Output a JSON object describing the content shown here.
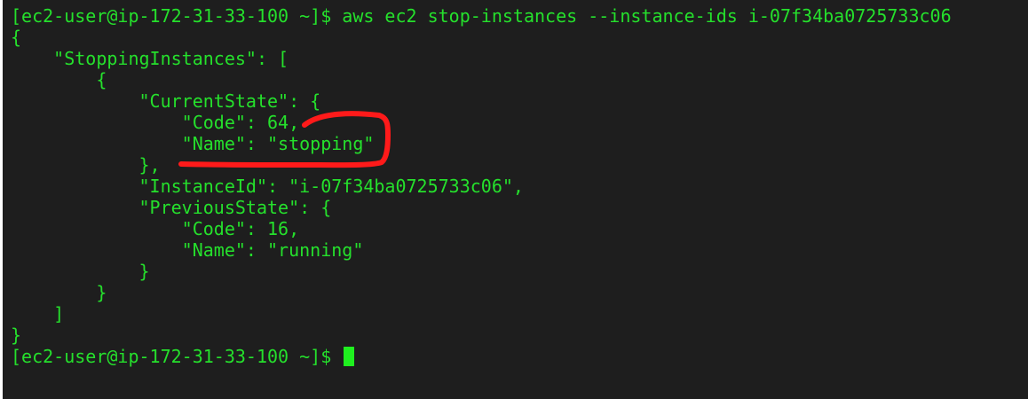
{
  "terminal": {
    "lines": [
      "[ec2-user@ip-172-31-33-100 ~]$ aws ec2 stop-instances --instance-ids i-07f34ba0725733c06",
      "{",
      "    \"StoppingInstances\": [",
      "        {",
      "            \"CurrentState\": {",
      "                \"Code\": 64,",
      "                \"Name\": \"stopping\"",
      "            },",
      "            \"InstanceId\": \"i-07f34ba0725733c06\",",
      "            \"PreviousState\": {",
      "                \"Code\": 16,",
      "                \"Name\": \"running\"",
      "            }",
      "        }",
      "    ]",
      "}"
    ],
    "prompt": "[ec2-user@ip-172-31-33-100 ~]$ ",
    "text_color": "#25e02c",
    "background_color": "#1e1e1e",
    "cursor_color": "#1ff01f",
    "annotation_color": "#ff1a1a"
  }
}
